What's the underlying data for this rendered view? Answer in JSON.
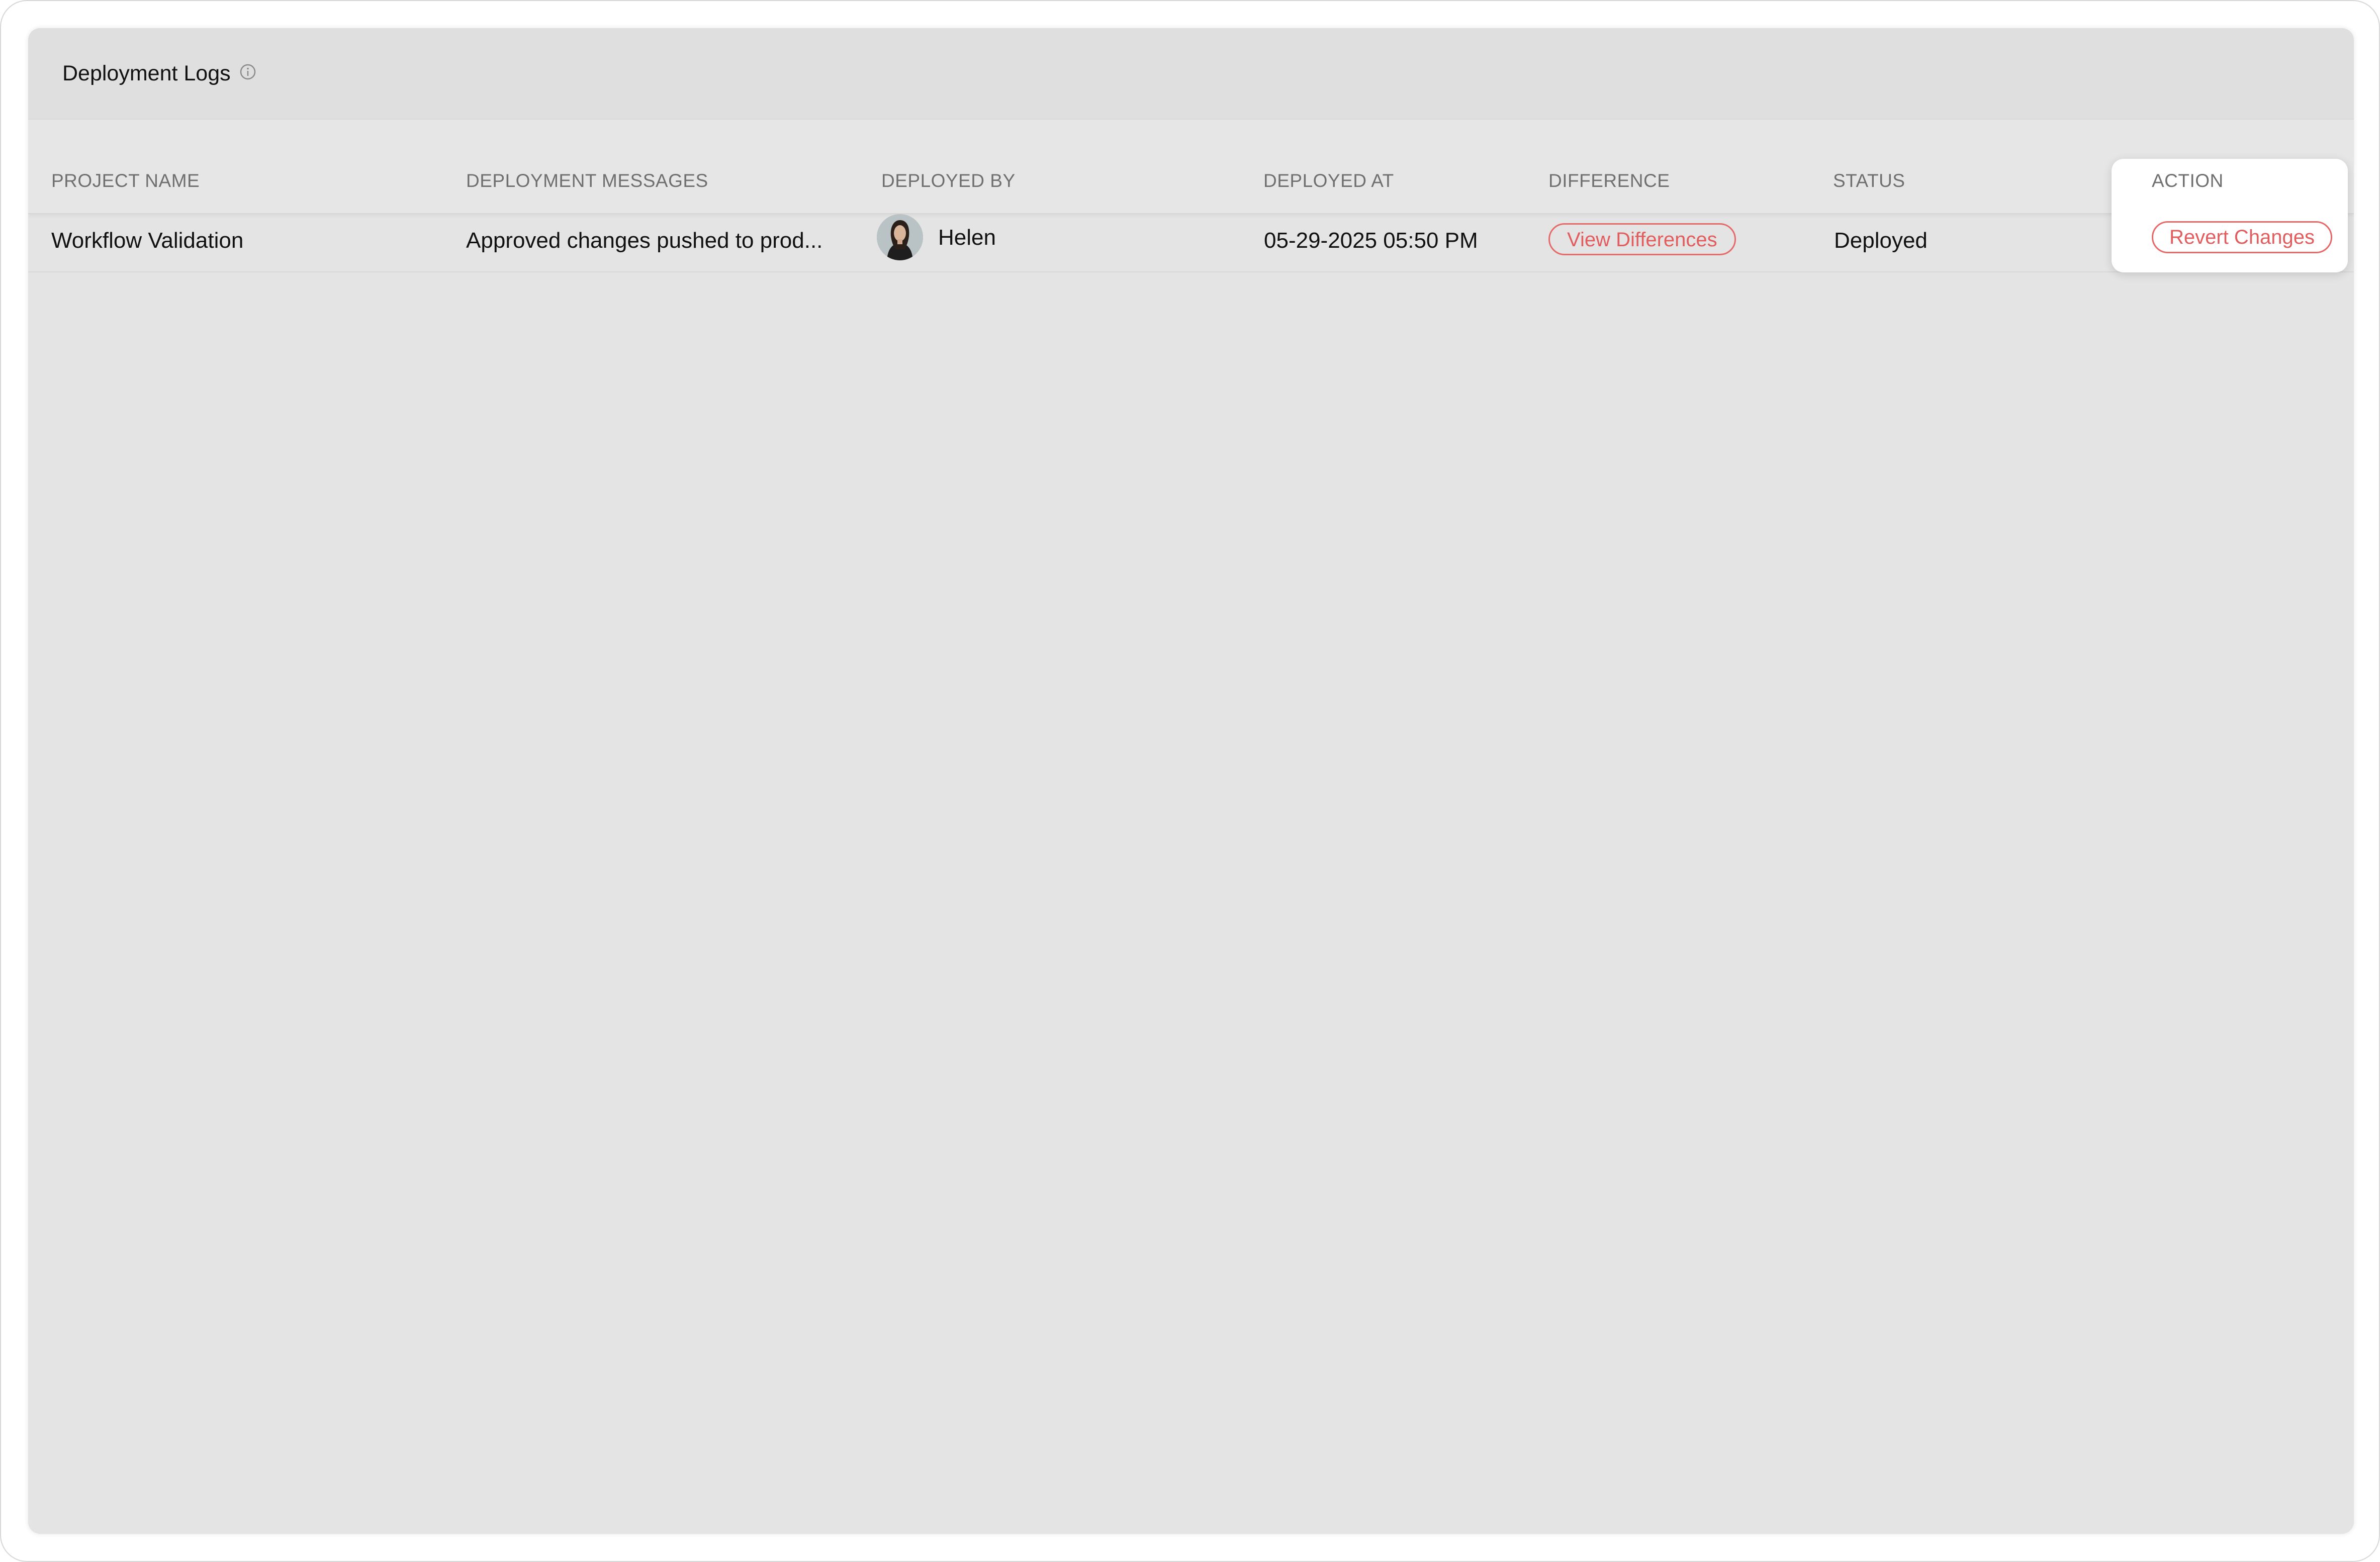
{
  "panel": {
    "title": "Deployment Logs",
    "info_icon": "info-circle-icon"
  },
  "table": {
    "columns": [
      "PROJECT NAME",
      "DEPLOYMENT MESSAGES",
      "DEPLOYED BY",
      "DEPLOYED AT",
      "DIFFERENCE",
      "STATUS",
      "ACTION"
    ],
    "rows": [
      {
        "project_name": "Workflow Validation",
        "message": "Approved changes pushed to prod...",
        "deployed_by": "Helen",
        "avatar_icon": "user-avatar",
        "deployed_at": "05-29-2025 05:50 PM",
        "difference_label": "View Differences",
        "status": "Deployed",
        "action_label": "Revert Changes"
      }
    ]
  },
  "colors": {
    "accent": "#e25d5d",
    "panel_bg": "#e4e4e4",
    "header_text": "#6f6f6f",
    "cell_text": "#111111"
  }
}
